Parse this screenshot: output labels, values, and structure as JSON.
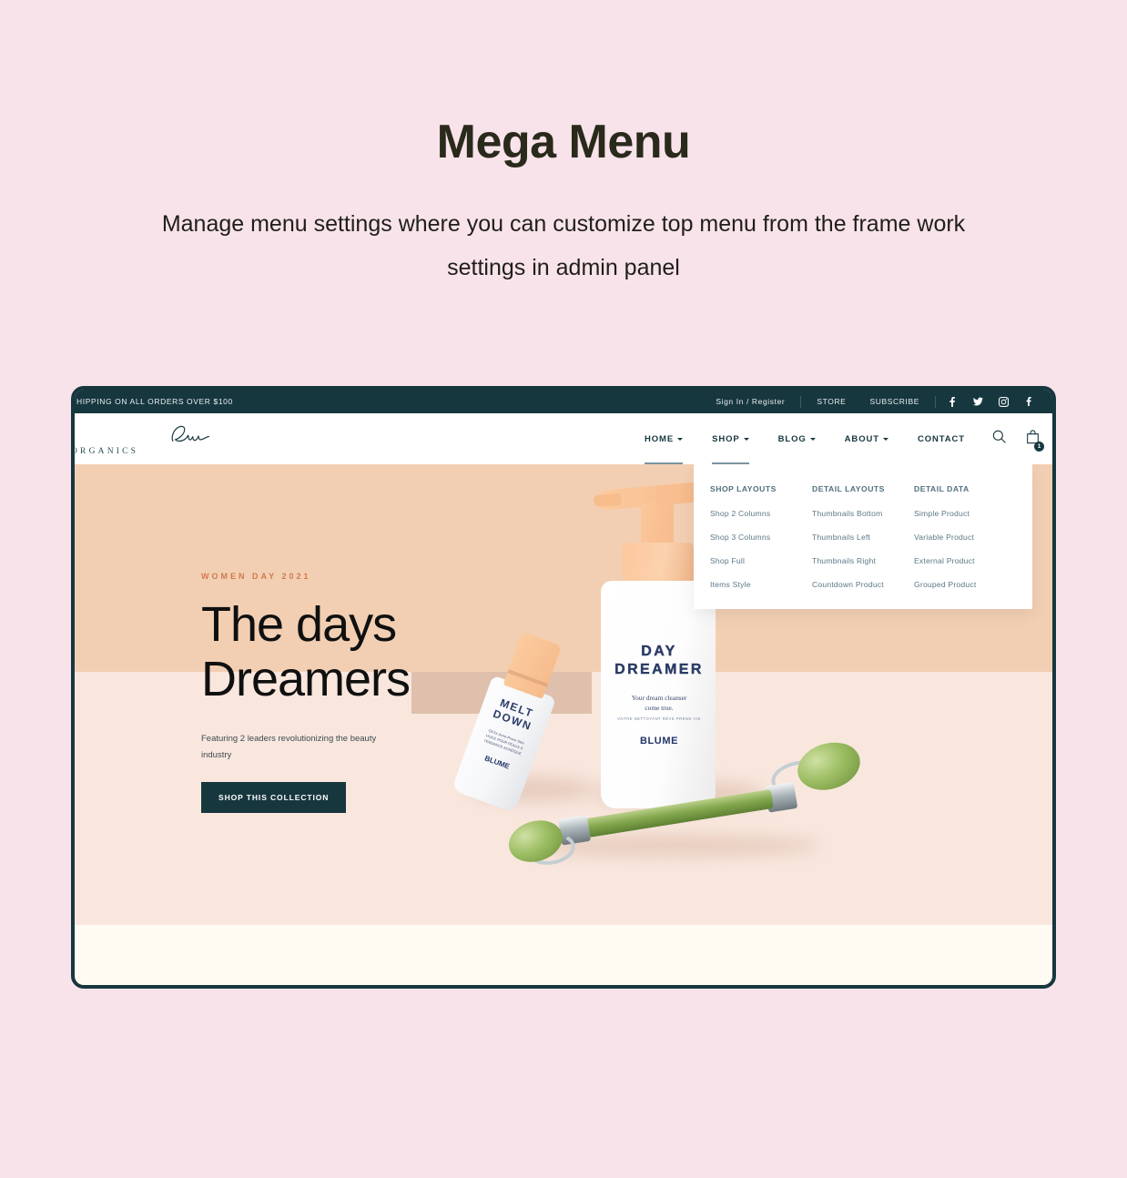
{
  "promo": {
    "title": "Mega Menu",
    "subtitle": "Manage menu settings where you can customize top menu from the frame work settings in admin panel"
  },
  "colors": {
    "page_background": "#F9E3EA",
    "frame_dark": "#17373F",
    "hero_peach": "#F2CFB3",
    "hero_blush": "#F9E7DE",
    "hero_cream": "#FFFAF2",
    "eyebrow_accent": "#D07A4E",
    "menu_link": "#5B7887"
  },
  "topbar": {
    "shipping": "HIPPING ON ALL ORDERS OVER $100",
    "sign_in": "Sign In / Register",
    "store": "STORE",
    "subscribe": "SUBSCRIBE",
    "social": [
      {
        "name": "facebook-icon",
        "glyph": "f"
      },
      {
        "name": "twitter-icon",
        "glyph": "t"
      },
      {
        "name": "instagram-icon",
        "glyph": "i"
      },
      {
        "name": "youtube-icon",
        "glyph": "y"
      }
    ]
  },
  "header": {
    "brand_word": "ORGANICS",
    "nav": [
      {
        "label": "HOME",
        "caret": true,
        "active": true
      },
      {
        "label": "SHOP",
        "caret": true,
        "active": true
      },
      {
        "label": "BLOG",
        "caret": true,
        "active": false
      },
      {
        "label": "ABOUT",
        "caret": true,
        "active": false
      },
      {
        "label": "CONTACT",
        "caret": false,
        "active": false
      }
    ],
    "search_icon": "search-icon",
    "cart_icon": "shopping-bag-icon",
    "cart_count": "1"
  },
  "megamenu": {
    "columns": [
      {
        "title": "SHOP LAYOUTS",
        "links": [
          "Shop 2 Columns",
          "Shop 3 Columns",
          "Shop Full",
          "Items Style"
        ]
      },
      {
        "title": "DETAIL LAYOUTS",
        "links": [
          "Thumbnails Bottom",
          "Thumbnails Left",
          "Thumbnails Right",
          "Countdown Product"
        ]
      },
      {
        "title": "DETAIL DATA",
        "links": [
          "Simple Product",
          "Variable Product",
          "External Product",
          "Grouped Product"
        ]
      }
    ]
  },
  "hero": {
    "eyebrow": "WOMEN DAY 2021",
    "heading_line1": "The days",
    "heading_line2": "Dreamers",
    "subtitle": "Featuring 2 leaders revolutionizing the beauty industry",
    "cta": "SHOP THIS COLLECTION"
  },
  "product_photo": {
    "big_bottle": {
      "name_line1": "DAY",
      "name_line2": "DREAMER",
      "tagline_line1": "Your dream cleanser",
      "tagline_line2": "come true.",
      "french": "VOTRE NETTOYANT RÊVE PREND VIE",
      "brand": "BLUME"
    },
    "small_bottle": {
      "name_line1": "MELT",
      "name_line2": "DOWN",
      "desc_line1": "Oil for Acne-Prone Skin",
      "desc_line2": "HUILE POUR PEAUX À",
      "desc_line3": "TENDANCE ACNÉIQUE",
      "brand": "BLUME"
    },
    "accessory": "jade-face-roller"
  }
}
